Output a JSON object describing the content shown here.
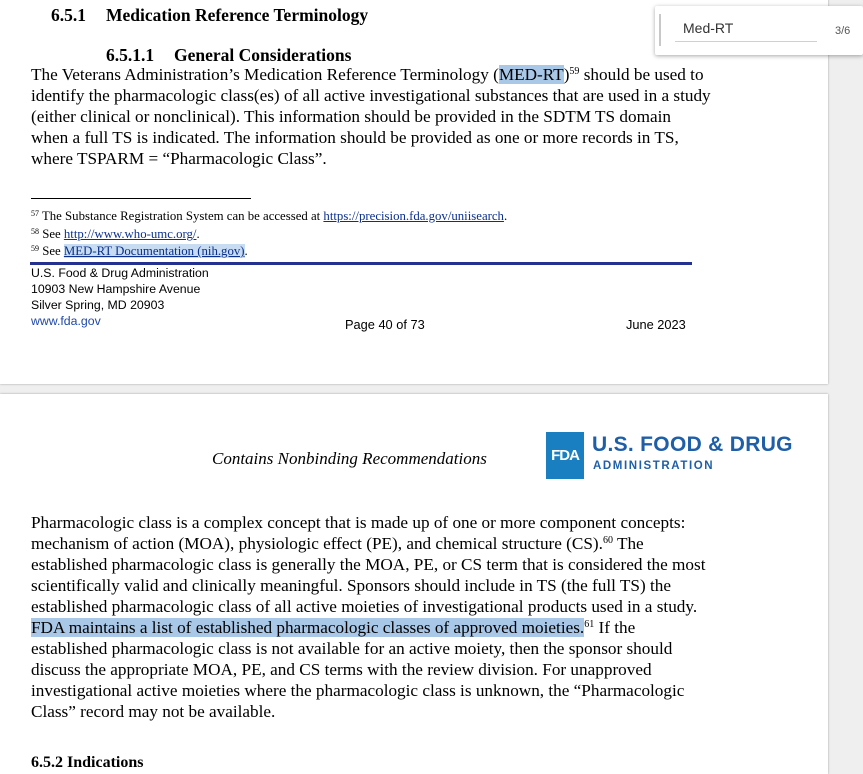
{
  "page1": {
    "section_heading": {
      "number": "6.5.1",
      "title": "Medication Reference Terminology"
    },
    "subsection_heading": {
      "number": "6.5.1.1",
      "title": "General Considerations"
    },
    "para": {
      "t1": "The Veterans Administration’s Medication Reference Terminology (",
      "hl": "MED-RT",
      "t2": ")",
      "sup": "59",
      "t3": " should be used to identify the pharmacologic class(es) of all active investigational substances that are used in a study (either clinical or nonclinical). This information should be provided in the SDTM TS domain when a full TS is indicated. The information should be provided as one or more records in TS, where TSPARM = “Pharmacologic Class”."
    },
    "footnotes": {
      "fn57": {
        "num": "57",
        "text": " The Substance Registration System can be accessed at ",
        "link": "https://precision.fda.gov/uniisearch",
        "tail": "."
      },
      "fn58": {
        "num": "58",
        "text": " See ",
        "link": "http://www.who-umc.org/",
        "tail": "."
      },
      "fn59": {
        "num": "59",
        "text": " See ",
        "link_hl": "MED-RT",
        "link": " Documentation (nih.gov)",
        "tail": "."
      }
    },
    "footer": {
      "address_line1": "U.S. Food & Drug Administration",
      "address_line2": "10903 New Hampshire Avenue",
      "address_line3": "Silver Spring, MD  20903",
      "website": "www.fda.gov",
      "page_number": "Page 40 of 73",
      "date": "June 2023"
    }
  },
  "page2": {
    "header": {
      "nonbinding": "Contains Nonbinding Recommendations",
      "logo_mark": "FDA",
      "logo_name": "U.S. FOOD & DRUG",
      "logo_sub": "ADMINISTRATION"
    },
    "para": {
      "t1": "Pharmacologic class is a complex concept that is made up of one or more component concepts: mechanism of action (MOA), physiologic effect (PE), and chemical structure (CS).",
      "sup60": "60",
      "t2": " The established pharmacologic class is generally the MOA, PE, or CS term that is considered the most scientifically valid and clinically meaningful. Sponsors should include in TS (the full TS) the established pharmacologic class of all active moieties of investigational products used in a study. ",
      "hl": "FDA maintains a list of established pharmacologic classes of approved moieties.",
      "sup61": "61",
      "t3": " If the established pharmacologic class is not available for an active moiety, then the sponsor should discuss the appropriate MOA, PE, and CS terms with the review division. For unapproved investigational active moieties where the pharmacologic class is unknown, the “Pharmacologic Class” record may not be available."
    },
    "cut_heading": "6.5.2  Indications"
  },
  "find_bar": {
    "query": "Med-RT",
    "count": "3/6"
  },
  "colors": {
    "highlight": "#a9c8e8",
    "fda_blue": "#1f5fa8",
    "footer_rule": "#25318f",
    "link": "#0b2f8c"
  }
}
